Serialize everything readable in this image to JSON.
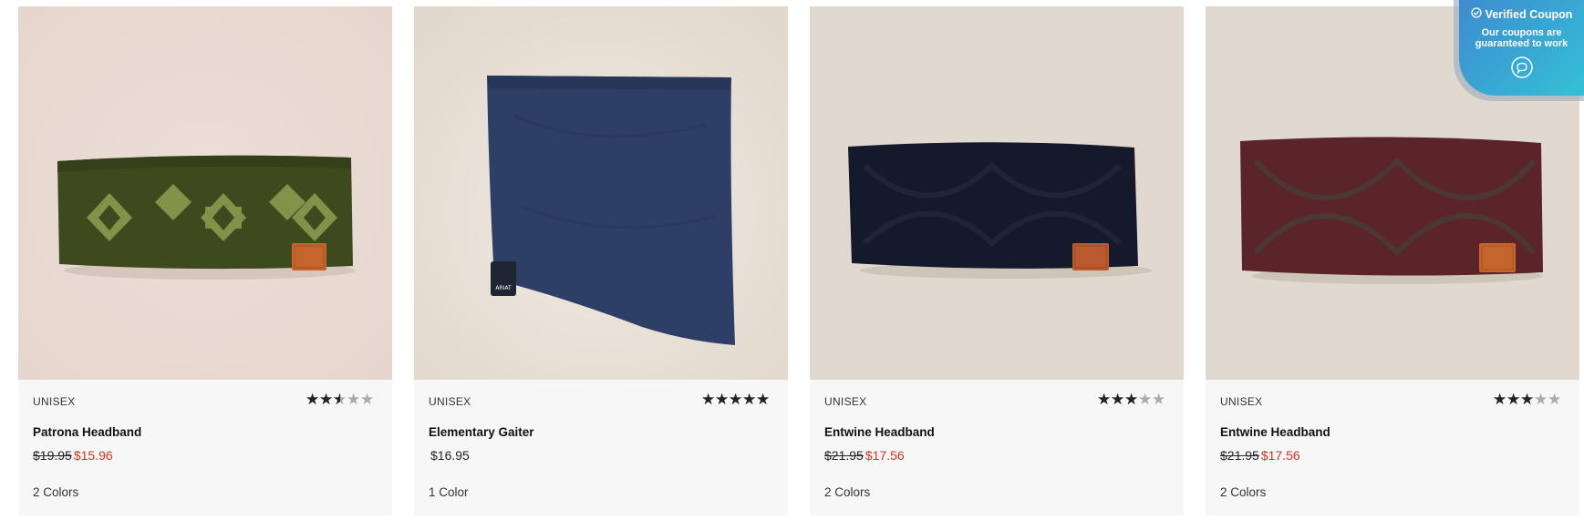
{
  "products": [
    {
      "gender": "UNISEX",
      "name": "Patrona Headband",
      "price_original": "$19.95",
      "price_sale": "$15.96",
      "price": "",
      "colors": "2 Colors",
      "rating": 2.5,
      "image": "olive-knit-headband"
    },
    {
      "gender": "UNISEX",
      "name": "Elementary Gaiter",
      "price_original": "",
      "price_sale": "",
      "price": "$16.95",
      "colors": "1 Color",
      "rating": 5,
      "image": "navy-fleece-gaiter"
    },
    {
      "gender": "UNISEX",
      "name": "Entwine Headband",
      "price_original": "$21.95",
      "price_sale": "$17.56",
      "price": "",
      "colors": "2 Colors",
      "rating": 3,
      "image": "black-cable-headband"
    },
    {
      "gender": "UNISEX",
      "name": "Entwine Headband",
      "price_original": "$21.95",
      "price_sale": "$17.56",
      "price": "",
      "colors": "2 Colors",
      "rating": 3,
      "image": "burgundy-cable-headband"
    }
  ],
  "coupon": {
    "title": "Verified Coupon",
    "text": "Our coupons are guaranteed to work",
    "icon": "chat-icon"
  },
  "colors": {
    "sale": "#d0341f",
    "star_filled": "#222222",
    "star_empty": "#aaaaaa",
    "card_bg": "#f7f7f7"
  }
}
